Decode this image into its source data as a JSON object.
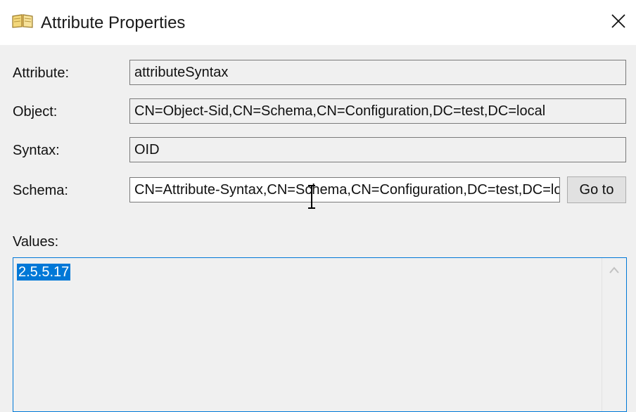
{
  "window": {
    "title": "Attribute Properties",
    "icon": "open-book-icon",
    "close_icon": "close-icon"
  },
  "fields": {
    "attribute": {
      "label": "Attribute:",
      "value": "attributeSyntax"
    },
    "object": {
      "label": "Object:",
      "value": "CN=Object-Sid,CN=Schema,CN=Configuration,DC=test,DC=local"
    },
    "syntax": {
      "label": "Syntax:",
      "value": "OID"
    },
    "schema": {
      "label": "Schema:",
      "value": "CN=Attribute-Syntax,CN=Schema,CN=Configuration,DC=test,DC=local"
    }
  },
  "goto_button": {
    "label": "Go to"
  },
  "values": {
    "label": "Values:",
    "items": [
      "2.5.5.17"
    ],
    "selected_index": 0
  },
  "colors": {
    "accent": "#0078d7",
    "dialog_bg": "#f0f0f0",
    "titlebar_bg": "#ffffff"
  }
}
